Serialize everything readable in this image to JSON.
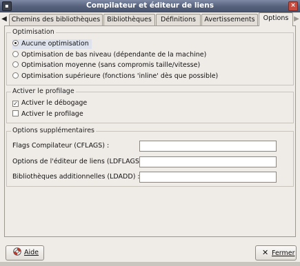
{
  "window": {
    "title": "Compilateur et éditeur de liens"
  },
  "tabs": [
    {
      "label": "Chemins des bibliothèques"
    },
    {
      "label": "Bibliothèques"
    },
    {
      "label": "Définitions"
    },
    {
      "label": "Avertissements"
    },
    {
      "label": "Options",
      "active": true
    }
  ],
  "optimisation": {
    "title": "Optimisation",
    "options": [
      {
        "label": "Aucune optimisation",
        "selected": true
      },
      {
        "label": "Optimisation de bas niveau (dépendante de la machine)",
        "selected": false
      },
      {
        "label": "Optimisation moyenne (sans compromis taille/vitesse)",
        "selected": false
      },
      {
        "label": "Optimisation supérieure (fonctions 'inline' dès que possible)",
        "selected": false
      }
    ]
  },
  "profilage": {
    "title": "Activer le profilage",
    "options": [
      {
        "label": "Activer le débogage",
        "checked": true
      },
      {
        "label": "Activer le profilage",
        "checked": false
      }
    ]
  },
  "supplementaires": {
    "title": "Options supplémentaires",
    "fields": [
      {
        "label": "Flags Compilateur (CFLAGS) :",
        "value": ""
      },
      {
        "label": "Options de l'éditeur de liens (LDFLAGS) :",
        "value": ""
      },
      {
        "label": "Bibliothèques additionnelles (LDADD) :",
        "value": ""
      }
    ]
  },
  "buttons": {
    "help": "Aide",
    "close": "Fermer"
  },
  "colors": {
    "title_bar": "#56617c",
    "window_bg": "#efebe7",
    "close_red": "#c64a3d"
  }
}
